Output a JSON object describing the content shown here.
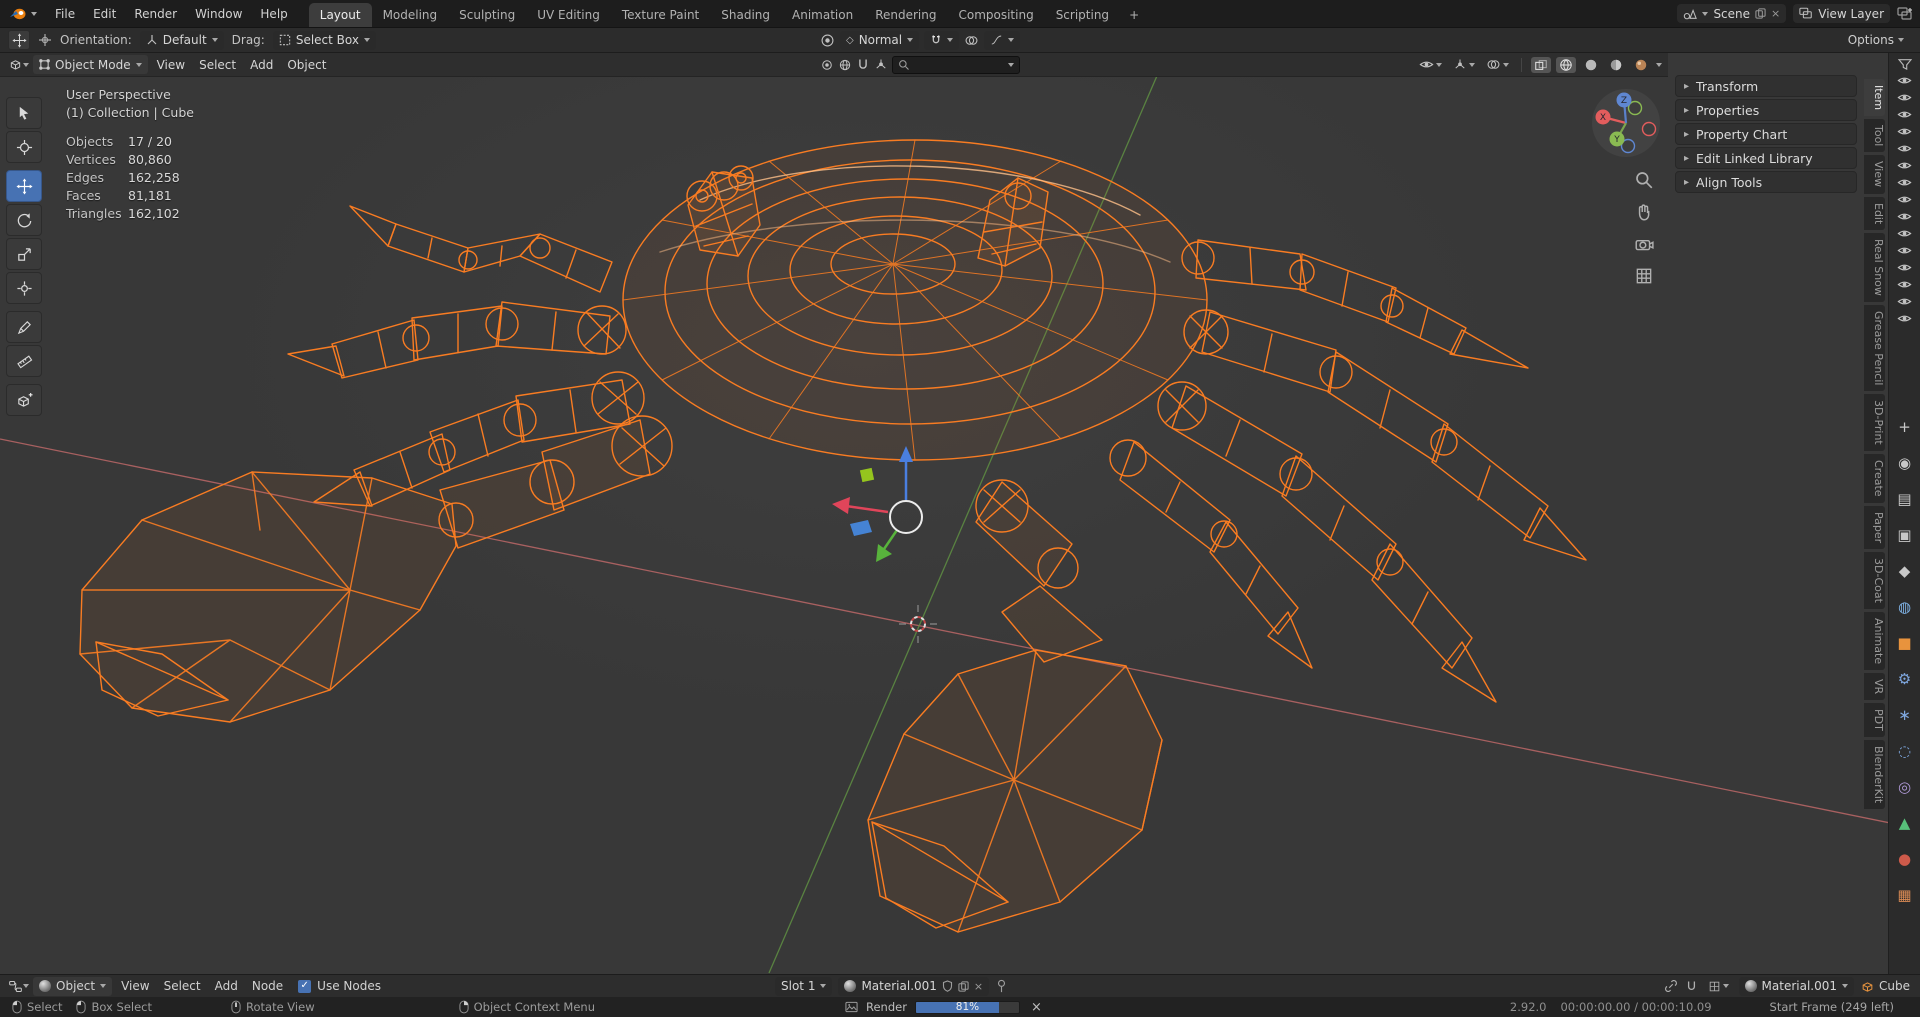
{
  "topbar": {
    "menus": [
      "File",
      "Edit",
      "Render",
      "Window",
      "Help"
    ],
    "workspaces": [
      {
        "label": "Layout",
        "active": true
      },
      {
        "label": "Modeling"
      },
      {
        "label": "Sculpting"
      },
      {
        "label": "UV Editing"
      },
      {
        "label": "Texture Paint"
      },
      {
        "label": "Shading"
      },
      {
        "label": "Animation"
      },
      {
        "label": "Rendering"
      },
      {
        "label": "Compositing"
      },
      {
        "label": "Scripting"
      }
    ],
    "add_workspace_label": "+",
    "scene_label": "Scene",
    "view_layer_label": "View Layer"
  },
  "tool_settings": {
    "orientation_label": "Orientation:",
    "orientation_value": "Default",
    "drag_label": "Drag:",
    "drag_value": "Select Box",
    "snap_value": "Normal",
    "options_label": "Options"
  },
  "viewport": {
    "header": {
      "mode": "Object Mode",
      "menus": [
        "View",
        "Select",
        "Add",
        "Object"
      ]
    },
    "overlay": {
      "view_name": "User Perspective",
      "collection": "(1) Collection | Cube",
      "stats": [
        {
          "label": "Objects",
          "value": "17 / 20"
        },
        {
          "label": "Vertices",
          "value": "80,860"
        },
        {
          "label": "Edges",
          "value": "162,258"
        },
        {
          "label": "Faces",
          "value": "81,181"
        },
        {
          "label": "Triangles",
          "value": "162,102"
        }
      ]
    },
    "nav_axes": {
      "x": "X",
      "y": "Y",
      "z": "Z"
    }
  },
  "sidebar": {
    "panels": [
      {
        "label": "Transform"
      },
      {
        "label": "Properties"
      },
      {
        "label": "Property Chart"
      },
      {
        "label": "Edit Linked Library"
      },
      {
        "label": "Align Tools"
      }
    ],
    "tabs": [
      {
        "label": "Item",
        "active": true
      },
      {
        "label": "Tool"
      },
      {
        "label": "View"
      },
      {
        "label": "Edit"
      },
      {
        "label": "Real Snow"
      },
      {
        "label": "Grease Pencil"
      },
      {
        "label": "3D-Print"
      },
      {
        "label": "Create"
      },
      {
        "label": "Paper"
      },
      {
        "label": "3D-Coat"
      },
      {
        "label": "Animate"
      },
      {
        "label": "VR"
      },
      {
        "label": "PDT"
      },
      {
        "label": "BlenderKit"
      }
    ]
  },
  "outliner": {
    "visibility_toggle_count": 15
  },
  "properties_tabs": [
    {
      "name": "tool",
      "glyph": "+",
      "color": "#c8c8c8"
    },
    {
      "name": "render",
      "glyph": "◉",
      "color": "#c8c8c8"
    },
    {
      "name": "output",
      "glyph": "▤",
      "color": "#c8c8c8"
    },
    {
      "name": "view-layer",
      "glyph": "▣",
      "color": "#c8c8c8"
    },
    {
      "name": "scene",
      "glyph": "◆",
      "color": "#c8c8c8"
    },
    {
      "name": "world",
      "glyph": "◍",
      "color": "#7fb2e5"
    },
    {
      "name": "object",
      "glyph": "■",
      "color": "#e8933d"
    },
    {
      "name": "modifiers",
      "glyph": "⚙",
      "color": "#7fa8e0"
    },
    {
      "name": "particles",
      "glyph": "∗",
      "color": "#7fa8e0"
    },
    {
      "name": "physics",
      "glyph": "◌",
      "color": "#7fa8e0"
    },
    {
      "name": "constraints",
      "glyph": "◎",
      "color": "#b09ad8"
    },
    {
      "name": "object-data",
      "glyph": "▲",
      "color": "#58c07a"
    },
    {
      "name": "material",
      "glyph": "●",
      "color": "#cd5a4a"
    },
    {
      "name": "texture",
      "glyph": "▦",
      "color": "#d98a54"
    }
  ],
  "shader_editor": {
    "type_value": "Object",
    "menus": [
      "View",
      "Select",
      "Add",
      "Node"
    ],
    "use_nodes_label": "Use Nodes",
    "check_glyph": "✓",
    "slot_value": "Slot 1",
    "material_field": "Material.001",
    "material_selector": "Material.001",
    "object_name": "Cube"
  },
  "statusbar": {
    "hints": [
      {
        "label": "Select"
      },
      {
        "label": "Box Select"
      },
      {
        "label": "Rotate View"
      },
      {
        "label": "Object Context Menu"
      }
    ],
    "render_label": "Render",
    "render_percent": 81,
    "render_percent_label": "81%",
    "close_glyph": "×",
    "version": "2.92.0",
    "time_info": "00:00:00.00 / 00:00:10.09",
    "frame_info": "Start Frame (249 left)"
  },
  "icons": {
    "disclosure": "▸"
  }
}
